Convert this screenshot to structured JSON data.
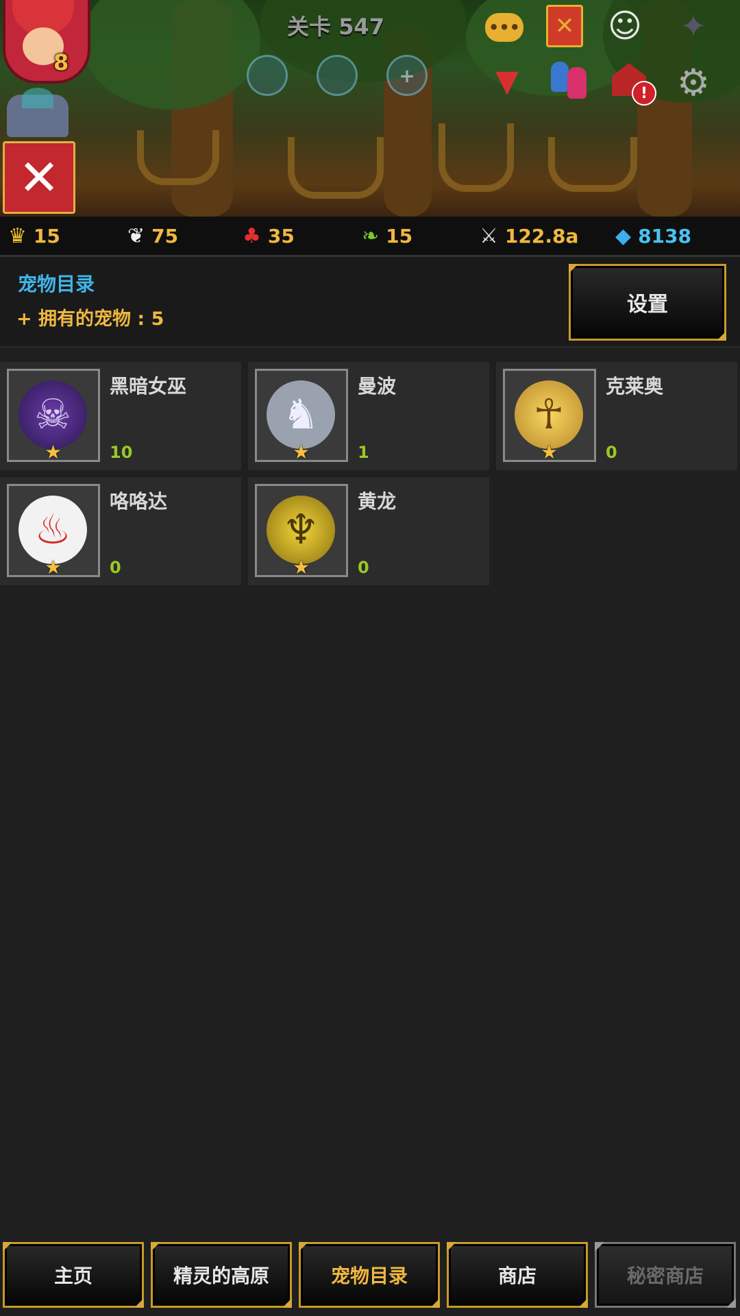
{
  "level": {
    "title": "关卡 547"
  },
  "player": {
    "avatar_level": "8"
  },
  "buttons": {
    "close_glyph": "✕",
    "settings_label": "设置"
  },
  "slots": [
    "",
    "",
    "+"
  ],
  "resources": [
    {
      "icon": "crown-icon",
      "value": "15"
    },
    {
      "icon": "feather-icon",
      "value": "75"
    },
    {
      "icon": "red-fruit-icon",
      "value": "35"
    },
    {
      "icon": "sprout-icon",
      "value": "15"
    },
    {
      "icon": "sword-icon",
      "value": "122.8a"
    },
    {
      "icon": "diamond-icon",
      "value": "8138"
    }
  ],
  "panel": {
    "title": "宠物目录",
    "owned_label": "+ 拥有的宠物 : 5"
  },
  "pets": [
    {
      "name": "黑暗女巫",
      "count": "10",
      "art": "witch-art"
    },
    {
      "name": "曼波",
      "count": "1",
      "art": "elephant-art"
    },
    {
      "name": "克莱奥",
      "count": "0",
      "art": "pharaoh-art"
    },
    {
      "name": "咯咯达",
      "count": "0",
      "art": "rooster-art"
    },
    {
      "name": "黄龙",
      "count": "0",
      "art": "dragon-art"
    }
  ],
  "nav": [
    {
      "label": "主页",
      "state": "normal"
    },
    {
      "label": "精灵的高原",
      "state": "normal"
    },
    {
      "label": "宠物目录",
      "state": "active"
    },
    {
      "label": "商店",
      "state": "normal"
    },
    {
      "label": "秘密商店",
      "state": "disabled"
    }
  ],
  "colors": {
    "accent_gold": "#f0b840",
    "title_blue": "#3fb6ea",
    "count_green": "#9ac82a",
    "close_red": "#c2282e"
  }
}
